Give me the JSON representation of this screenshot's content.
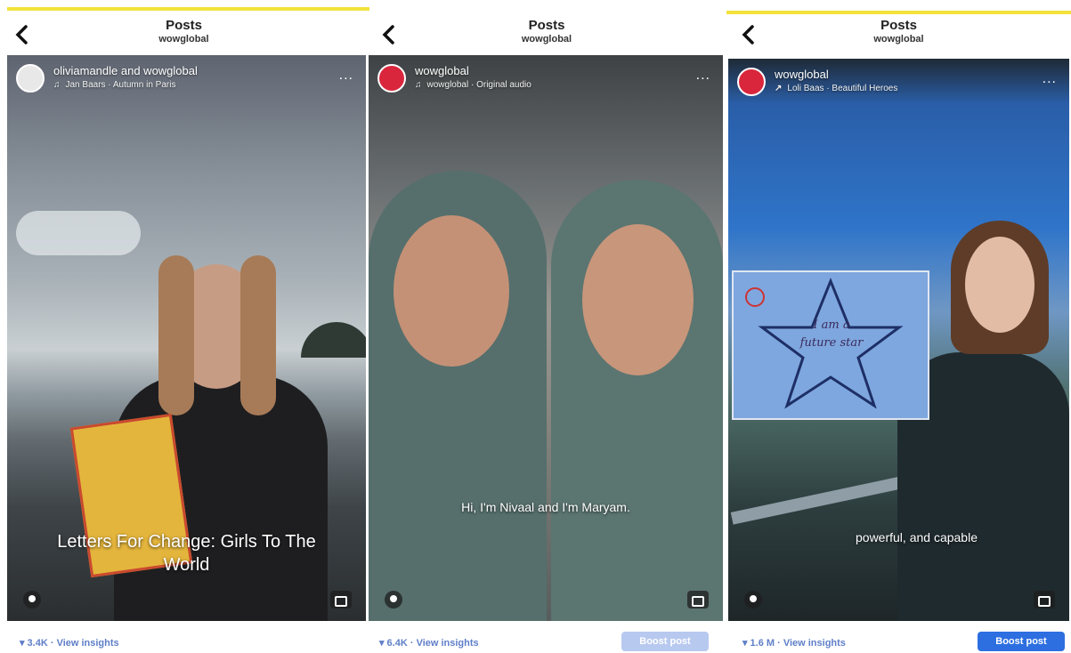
{
  "header": {
    "title": "Posts",
    "subtitle": "wowglobal"
  },
  "colors": {
    "top_accent": "#f2e23a",
    "link": "#5f7fc8",
    "boost_faded": "#b8c9f0",
    "boost_active": "#2d6fe0"
  },
  "posts": [
    {
      "author": "oliviamandle and wowglobal",
      "audio": "Jan Baars · Autumn in Paris",
      "caption": "Letters For Change: Girls To The World",
      "views": "3.4K",
      "insights_label": "View insights",
      "more_label": "...",
      "icons": {
        "back": "chevron-left-icon",
        "audio": "music-note-icon",
        "more": "more-icon",
        "bottom_left": "camera-icon",
        "bottom_right": "mute-icon"
      }
    },
    {
      "author": "wowglobal",
      "audio": "wowglobal · Original audio",
      "caption": "Hi, I'm Nivaal and I'm Maryam.",
      "views": "6.4K",
      "insights_label": "View insights",
      "boost_label": "Boost post",
      "more_label": "...",
      "icons": {
        "back": "chevron-left-icon",
        "audio": "music-note-icon",
        "more": "more-icon",
        "bottom_left": "person-icon",
        "bottom_right": "mute-icon"
      }
    },
    {
      "author": "wowglobal",
      "audio": "Loli Baas · Beautiful Heroes",
      "caption": "powerful, and capable",
      "sign_text": "I am a future star",
      "views": "1.6 M",
      "insights_label": "View insights",
      "boost_label": "Boost post",
      "more_label": "...",
      "icons": {
        "back": "chevron-left-icon",
        "audio": "trend-icon",
        "more": "more-icon",
        "bottom_left": "person-icon",
        "bottom_right": "mute-icon"
      }
    }
  ]
}
